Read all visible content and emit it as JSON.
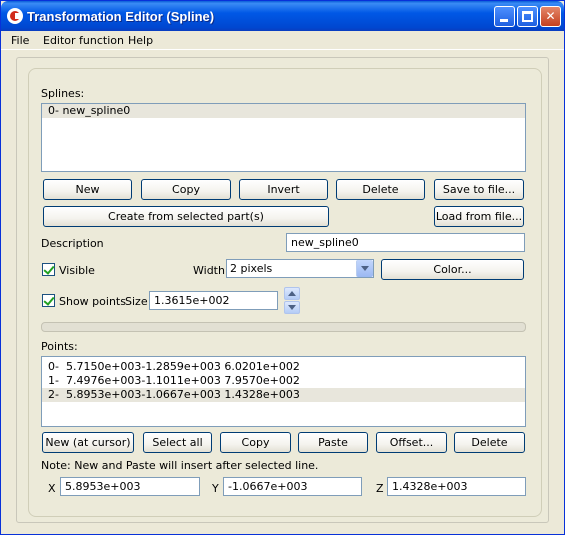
{
  "window": {
    "title": "Transformation Editor (Spline)"
  },
  "menu": [
    "File",
    "Editor function",
    "Help"
  ],
  "splines": {
    "label": "Splines:",
    "items": [
      "0- new_spline0"
    ],
    "buttons": {
      "new": "New",
      "copy": "Copy",
      "invert": "Invert",
      "delete": "Delete",
      "save": "Save to file...",
      "create_from_part": "Create from selected part(s)",
      "load": "Load from file..."
    }
  },
  "description": {
    "label": "Description",
    "value": "new_spline0"
  },
  "visible": {
    "label": "Visible",
    "checked": true
  },
  "width": {
    "label": "Width",
    "value": "2 pixels"
  },
  "color_button": "Color...",
  "show_points": {
    "label": "Show points",
    "checked": true,
    "size_label": "Size",
    "size_value": "1.3615e+002"
  },
  "points": {
    "label": "Points:",
    "items": [
      "0-  5.7150e+003-1.2859e+003 6.0201e+002",
      "1-  7.4976e+003-1.1011e+003 7.9570e+002",
      "2-  5.8953e+003-1.0667e+003 1.4328e+003"
    ],
    "selected_index": 2,
    "buttons": {
      "new_at_cursor": "New (at cursor)",
      "select_all": "Select all",
      "copy": "Copy",
      "paste": "Paste",
      "offset": "Offset...",
      "delete": "Delete"
    }
  },
  "note": "Note: New and Paste will insert after selected line.",
  "coords": {
    "x_label": "X",
    "x_value": "5.8953e+003",
    "y_label": "Y",
    "y_value": "-1.0667e+003",
    "z_label": "Z",
    "z_value": "1.4328e+003"
  },
  "colors": {
    "titlebar": "#0058e6",
    "panel": "#ece9d8",
    "selection": "#e8e6dc"
  }
}
